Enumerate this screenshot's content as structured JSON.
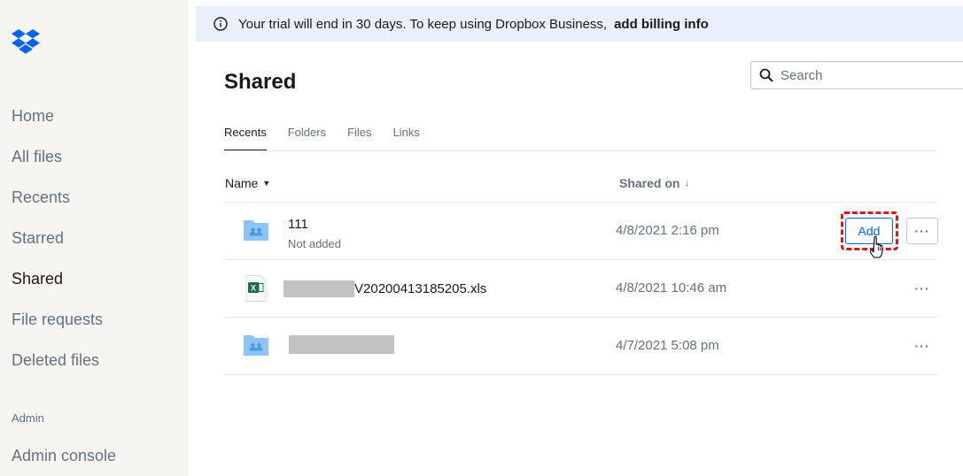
{
  "sidebar": {
    "nav": [
      {
        "label": "Home",
        "active": false
      },
      {
        "label": "All files",
        "active": false
      },
      {
        "label": "Recents",
        "active": false
      },
      {
        "label": "Starred",
        "active": false
      },
      {
        "label": "Shared",
        "active": true
      },
      {
        "label": "File requests",
        "active": false
      },
      {
        "label": "Deleted files",
        "active": false
      }
    ],
    "section_label": "Admin",
    "admin_item": "Admin console"
  },
  "banner": {
    "icon": "info-icon",
    "message": "Your trial will end in 30 days. To keep using Dropbox Business,",
    "link": "add billing info"
  },
  "page": {
    "title": "Shared"
  },
  "search": {
    "placeholder": "Search",
    "value": ""
  },
  "tabs": [
    {
      "label": "Recents",
      "active": true
    },
    {
      "label": "Folders",
      "active": false
    },
    {
      "label": "Files",
      "active": false
    },
    {
      "label": "Links",
      "active": false
    }
  ],
  "columns": {
    "name": "Name",
    "shared_on": "Shared on"
  },
  "rows": [
    {
      "type": "shared-folder",
      "name": "111",
      "sub": "Not added",
      "shared_on": "4/8/2021 2:16 pm",
      "action": "Add",
      "more": "···"
    },
    {
      "type": "excel-file",
      "name": "V20200413185205.xls",
      "shared_on": "4/8/2021 10:46 am",
      "more": "···"
    },
    {
      "type": "shared-folder",
      "name": "",
      "shared_on": "4/7/2021 5:08 pm",
      "more": "···"
    }
  ],
  "colors": {
    "accent": "#0061fe",
    "highlight": "#e01515",
    "folder": "#8bc4f5",
    "sidebar_bg": "#f7f5f2",
    "banner_bg": "#e9f0fb"
  }
}
